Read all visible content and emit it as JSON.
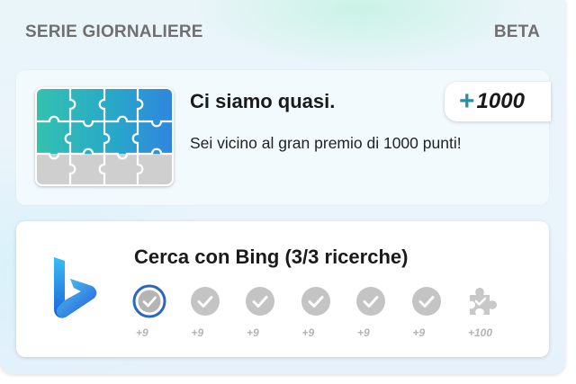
{
  "header": {
    "title": "SERIE GIORNALIERE",
    "badge": "BETA"
  },
  "bonus_card": {
    "title": "Ci siamo quasi.",
    "description": "Sei vicino al gran premio di 1000 punti!",
    "badge_plus": "+",
    "badge_points": "1000",
    "image_icon": "puzzle-image-icon"
  },
  "search_card": {
    "title": "Cerca con Bing (3/3 ricerche)",
    "logo_icon": "bing-logo-icon",
    "steps": [
      {
        "points": "+9",
        "state": "current",
        "icon": "check-circle-icon"
      },
      {
        "points": "+9",
        "state": "pending",
        "icon": "check-circle-icon"
      },
      {
        "points": "+9",
        "state": "pending",
        "icon": "check-circle-icon"
      },
      {
        "points": "+9",
        "state": "pending",
        "icon": "check-circle-icon"
      },
      {
        "points": "+9",
        "state": "pending",
        "icon": "check-circle-icon"
      },
      {
        "points": "+9",
        "state": "pending",
        "icon": "check-circle-icon"
      },
      {
        "points": "+100",
        "state": "reward",
        "icon": "puzzle-piece-icon"
      }
    ]
  },
  "colors": {
    "accent": "#2b8fa6",
    "current_ring": "#2a67c2",
    "inactive": "#c4c4c4"
  }
}
